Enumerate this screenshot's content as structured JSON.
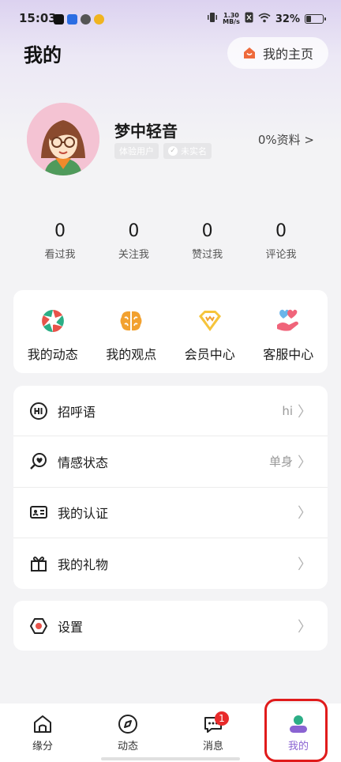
{
  "status_bar": {
    "time": "15:03",
    "speed_top": "1.30",
    "speed_bottom": "MB/s",
    "battery": "32%"
  },
  "header": {
    "title": "我的",
    "home_button": "我的主页"
  },
  "profile": {
    "nickname": "梦中轻音",
    "tag_trial": "体验用户",
    "tag_unverified": "未实名",
    "completeness": "0%资料 >"
  },
  "stats": [
    {
      "value": "0",
      "label": "看过我"
    },
    {
      "value": "0",
      "label": "关注我"
    },
    {
      "value": "0",
      "label": "赞过我"
    },
    {
      "value": "0",
      "label": "评论我"
    }
  ],
  "quick_actions": [
    {
      "label": "我的动态",
      "icon": "aperture-icon"
    },
    {
      "label": "我的观点",
      "icon": "brain-icon"
    },
    {
      "label": "会员中心",
      "icon": "diamond-icon"
    },
    {
      "label": "客服中心",
      "icon": "heart-hand-icon"
    }
  ],
  "menu": [
    {
      "label": "招呼语",
      "value": "hi",
      "icon": "hi-icon"
    },
    {
      "label": "情感状态",
      "value": "单身",
      "icon": "heart-search-icon"
    },
    {
      "label": "我的认证",
      "value": "",
      "icon": "id-card-icon"
    },
    {
      "label": "我的礼物",
      "value": "",
      "icon": "gift-icon"
    }
  ],
  "settings": {
    "label": "设置",
    "icon": "gear-icon"
  },
  "tabbar": [
    {
      "label": "缘分",
      "icon": "home-icon"
    },
    {
      "label": "动态",
      "icon": "compass-icon"
    },
    {
      "label": "消息",
      "icon": "chat-icon",
      "badge": "1"
    },
    {
      "label": "我的",
      "icon": "profile-icon"
    }
  ],
  "colors": {
    "accent": "#8a63d2",
    "badge": "#e82a2a",
    "highlight": "#e01b1b"
  }
}
